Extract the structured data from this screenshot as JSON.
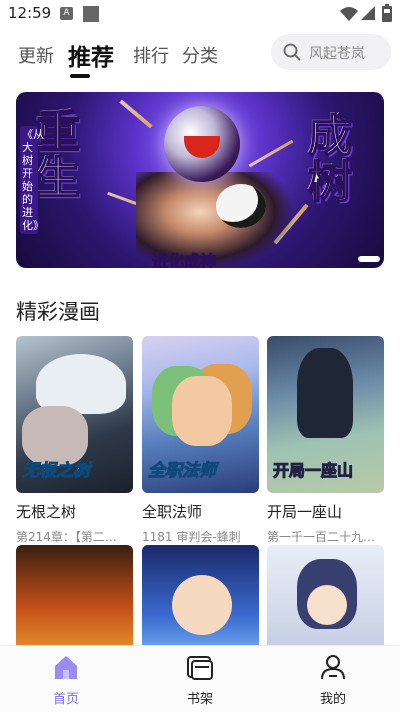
{
  "status_bar": {
    "time": "12:59",
    "icon_a": "A"
  },
  "top_tabs": {
    "items": [
      {
        "label": "更新",
        "active": false
      },
      {
        "label": "推荐",
        "active": true
      },
      {
        "label": "排行",
        "active": false
      },
      {
        "label": "分类",
        "active": false
      }
    ],
    "search_placeholder": "风起苍岚"
  },
  "banner": {
    "title_left": "重生",
    "title_right": "成树",
    "side_caption": "《从大树开始的进化》",
    "subtitle": "进化成神",
    "accent": "#5a32c8"
  },
  "section": {
    "title": "精彩漫画",
    "items": [
      {
        "name": "无根之树",
        "sub": "第214章：【第二…",
        "cover_text": "无根之树"
      },
      {
        "name": "全职法师",
        "sub": "1181 审判会-蜂刺",
        "cover_text": "全职法师"
      },
      {
        "name": "开局一座山",
        "sub": "第一千一百二十九…",
        "cover_text": "开局一座山"
      },
      {
        "name": "",
        "sub": "",
        "cover_text": ""
      },
      {
        "name": "",
        "sub": "",
        "cover_text": ""
      },
      {
        "name": "",
        "sub": "",
        "cover_text": ""
      }
    ]
  },
  "bottom_nav": {
    "items": [
      {
        "label": "首页",
        "icon": "home-icon",
        "active": true
      },
      {
        "label": "书架",
        "icon": "bookshelf-icon",
        "active": false
      },
      {
        "label": "我的",
        "icon": "profile-icon",
        "active": false
      }
    ],
    "active_color": "#7c6cf0"
  }
}
